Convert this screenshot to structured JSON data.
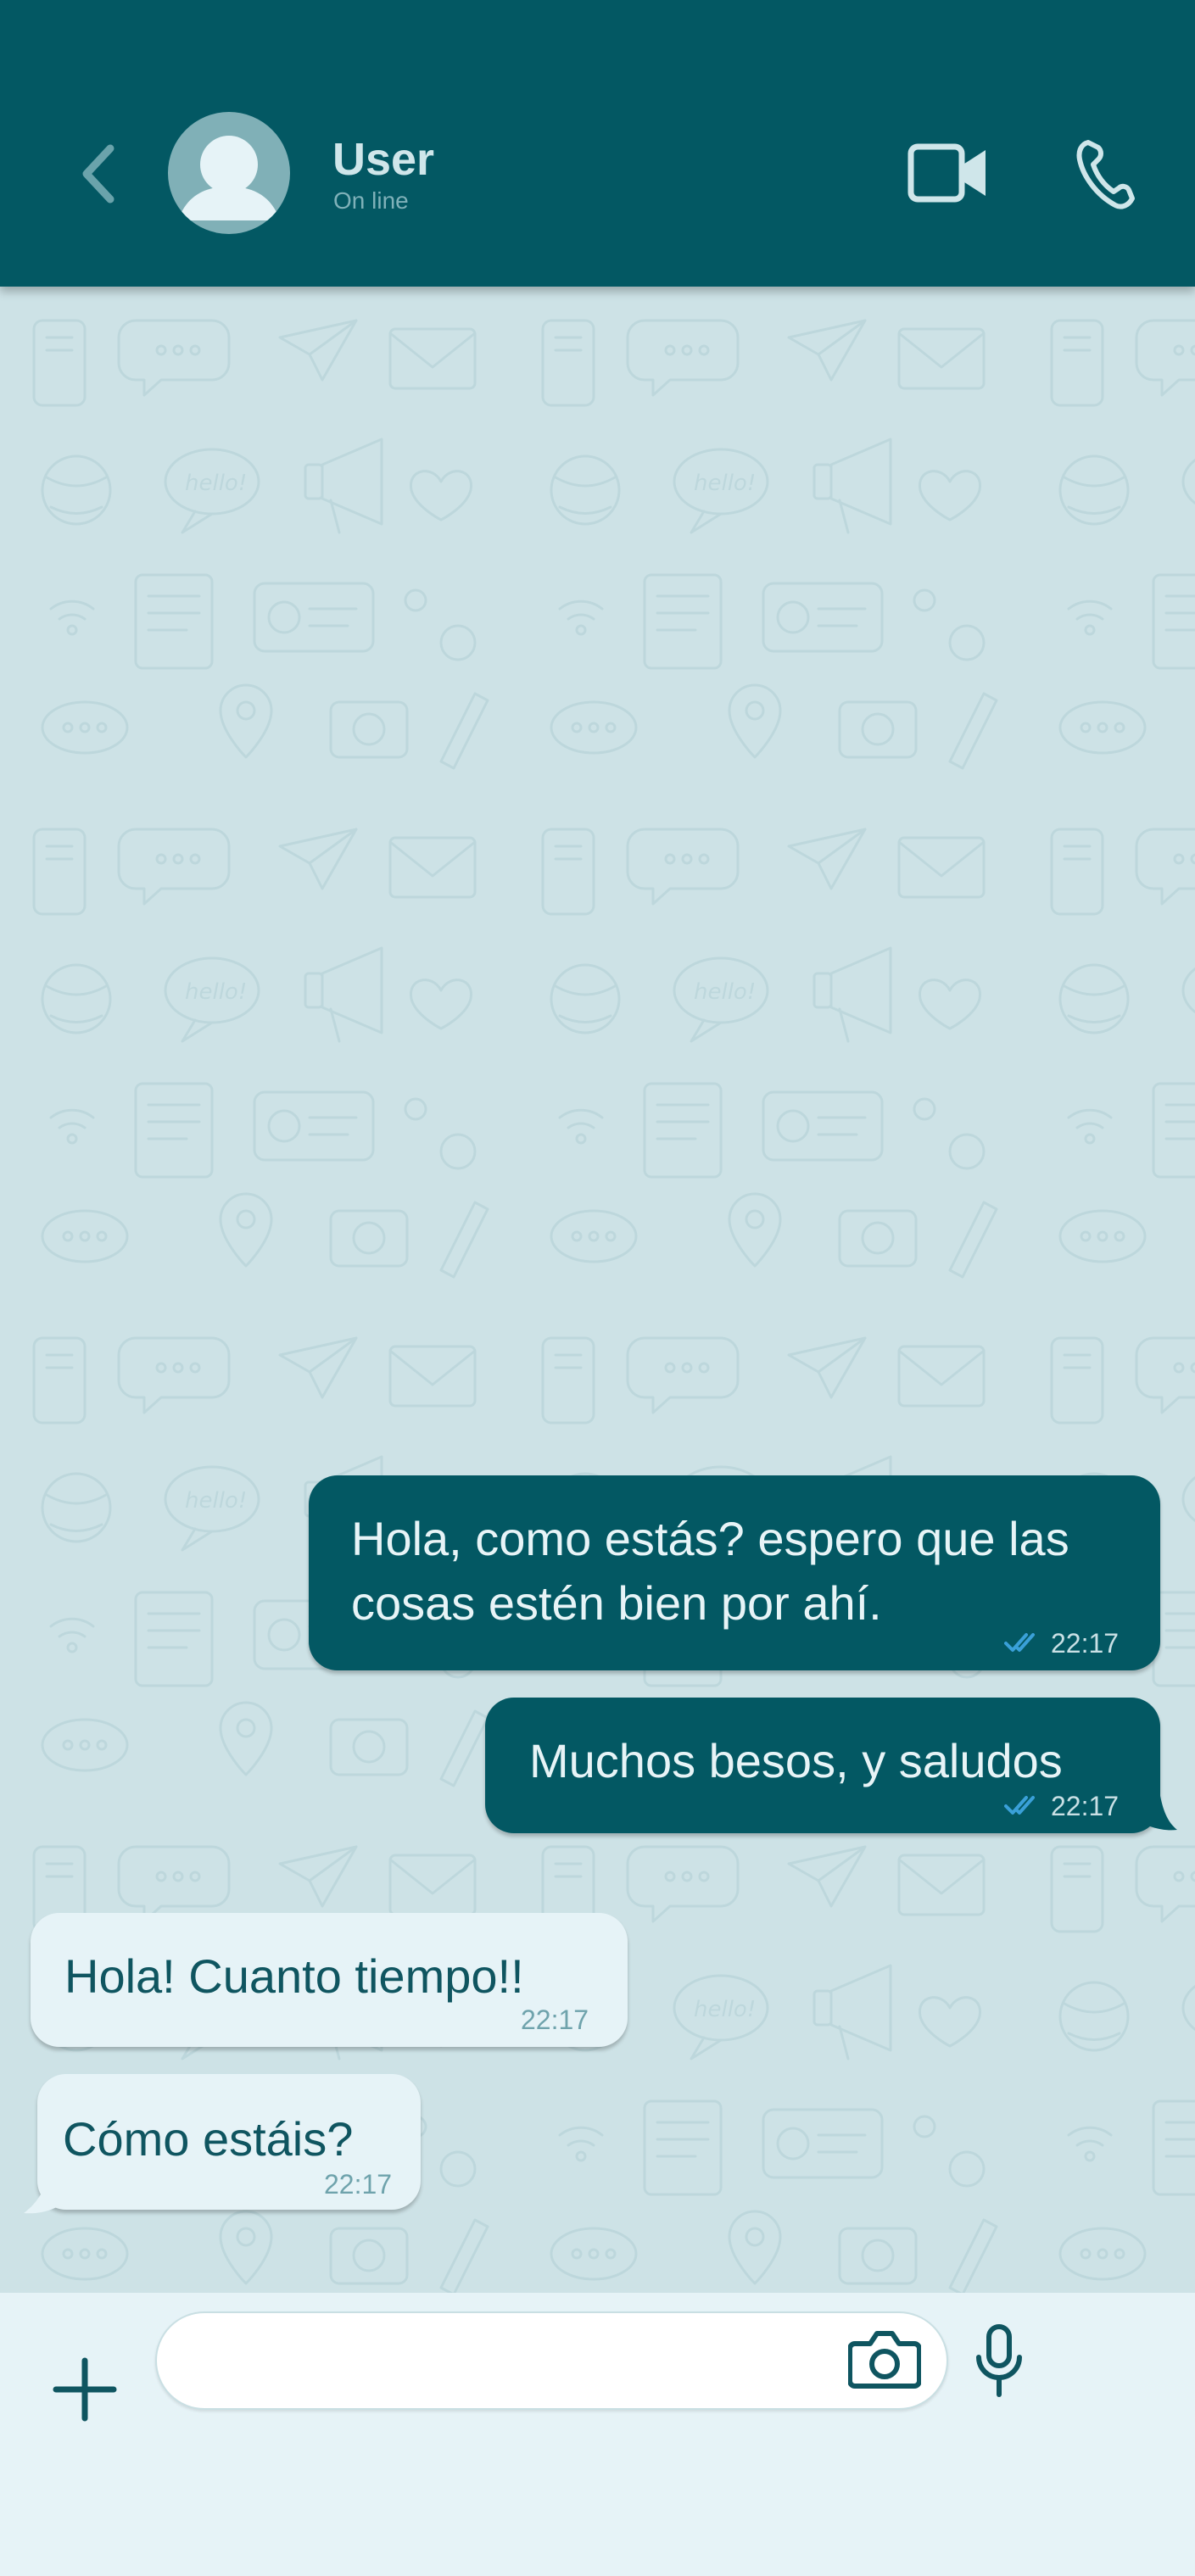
{
  "header": {
    "contact_name": "User",
    "contact_status": "On line"
  },
  "messages": [
    {
      "direction": "out",
      "lines": [
        "Hola, como estás? espero que las",
        "cosas estén bien por ahí."
      ],
      "time": "22:17",
      "read": true
    },
    {
      "direction": "out",
      "lines": [
        "Muchos besos, y saludos"
      ],
      "time": "22:17",
      "read": true
    },
    {
      "direction": "in",
      "lines": [
        "Hola! Cuanto tiempo!!"
      ],
      "time": "22:17"
    },
    {
      "direction": "in",
      "lines": [
        "Cómo estáis?"
      ],
      "time": "22:17"
    }
  ],
  "composer": {
    "value": "",
    "placeholder": ""
  },
  "icons": {
    "back": "chevron-left-icon",
    "avatar": "user-avatar-icon",
    "video": "video-camera-icon",
    "call": "phone-icon",
    "add": "plus-icon",
    "camera": "camera-icon",
    "mic": "microphone-icon",
    "read": "double-check-icon"
  },
  "colors": {
    "header": "#035863",
    "chat_background": "#cde2e6",
    "outgoing_bubble": "#035863",
    "incoming_bubble": "#e6f3f7",
    "read_ticks": "#3aa0d8",
    "icon_accent": "#0f5560"
  }
}
